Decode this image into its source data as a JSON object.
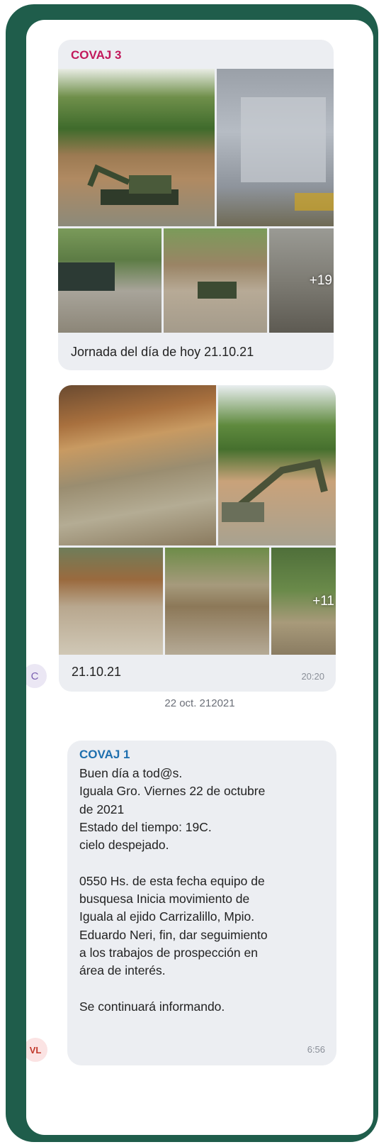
{
  "messages": [
    {
      "sender": "COVAJ 3",
      "sender_color": "#c2185b",
      "photos_more": "+19",
      "caption": "Jornada del día de hoy 21.10.21"
    },
    {
      "photos_more": "+11",
      "caption": "21.10.21",
      "time": "20:20",
      "avatar_initials": "C"
    }
  ],
  "date_separator": "22 oct. 212021",
  "text_message": {
    "sender": "COVAJ 1",
    "sender_color": "#1e6fae",
    "body": "Buen día a tod@s.\nIguala Gro. Viernes 22 de octubre\nde 2021\nEstado del tiempo:  19C.\ncielo despejado.\n\n0550 Hs.  de esta fecha equipo de\nbusquesa Inicia movimiento de\nIguala al ejido Carrizalillo, Mpio.\nEduardo Neri,  fin, dar seguimiento\na los trabajos de prospección en\nárea de interés.\n\nSe continuará informando.",
    "time": "6:56",
    "avatar_initials": "VL"
  }
}
